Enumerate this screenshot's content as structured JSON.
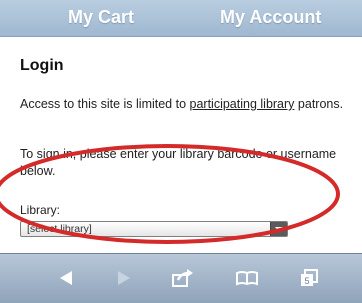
{
  "top_nav": {
    "cart_label": "My Cart",
    "account_label": "My Account"
  },
  "login": {
    "title": "Login",
    "access_text_before_link": "Access to this site is limited to ",
    "access_link_text": "participating library",
    "access_text_after_link": " patrons.",
    "signin_text": "To sign in, please enter your library barcode or username below.",
    "library_label": "Library:",
    "library_select_value": "[select library]"
  },
  "annotation": {
    "highlight_color": "#d42a2a"
  },
  "bottom_toolbar": {
    "icons": [
      "back-icon",
      "forward-icon",
      "share-icon",
      "bookmarks-icon",
      "tabs-icon"
    ]
  },
  "colors": {
    "top_bar": "#a9c0d8",
    "toolbar": "#a3b5c9"
  }
}
